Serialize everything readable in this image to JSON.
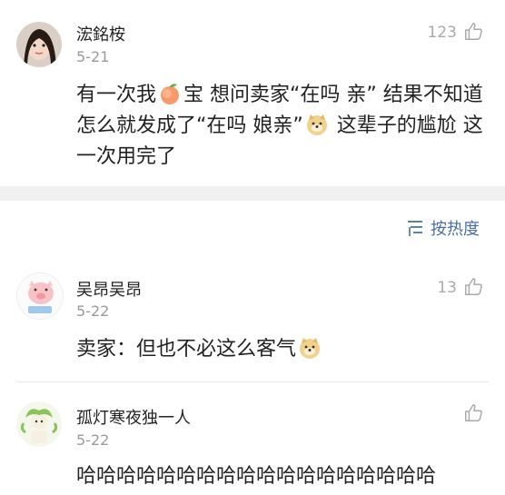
{
  "comments": [
    {
      "username": "浤銘桉",
      "date": "5-21",
      "likes": "123",
      "text_parts": [
        "有一次我",
        "宝 想问卖家“在吗 亲” 结果不知道怎么就发成了“在吗 娘亲”",
        " 这辈子的尴尬 这一次用完了"
      ],
      "emojis": [
        "peach-emoji",
        "doge-emoji"
      ]
    },
    {
      "username": "吴昂吴昂",
      "date": "5-22",
      "likes": "13",
      "text": "卖家：但也不必这么客气",
      "emojis": [
        "doge-emoji"
      ]
    },
    {
      "username": "孤灯寒夜独一人",
      "date": "5-22",
      "likes": "",
      "text": "哈哈哈哈哈哈哈哈哈哈哈哈哈哈哈哈哈哈"
    }
  ],
  "sort": {
    "label": "按热度"
  },
  "colors": {
    "accent": "#4a6fa0",
    "muted": "#9a9a9a",
    "band": "#f1f1f1"
  }
}
